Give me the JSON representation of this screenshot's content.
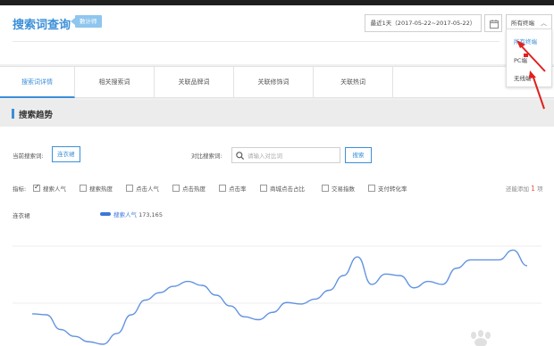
{
  "header": {
    "title": "搜索词查询",
    "badge": "數计师",
    "date_range": "最近1天（2017-05-22~2017-05-22）",
    "terminal_selected": "所有终端",
    "terminal_options": [
      "所有终端",
      "PC端",
      "无线端"
    ]
  },
  "tabs": [
    {
      "label": "搜索词详情",
      "active": true
    },
    {
      "label": "相关搜索词",
      "active": false
    },
    {
      "label": "关联品牌词",
      "active": false
    },
    {
      "label": "关联修饰词",
      "active": false
    },
    {
      "label": "关联热词",
      "active": false
    }
  ],
  "section": {
    "title": "搜索趋势"
  },
  "filters": {
    "current_label": "当前搜索词:",
    "current_value": "连衣裙",
    "compare_label": "对比搜索词:",
    "compare_placeholder": "请输入对比词",
    "search_label": "搜索"
  },
  "metrics": {
    "label": "指标:",
    "items": [
      {
        "label": "搜索人气",
        "checked": true
      },
      {
        "label": "搜索热度",
        "checked": false
      },
      {
        "label": "点击人气",
        "checked": false
      },
      {
        "label": "点击热度",
        "checked": false
      },
      {
        "label": "点击率",
        "checked": false
      },
      {
        "label": "商城点击占比",
        "checked": false
      },
      {
        "label": "交易指数",
        "checked": false
      },
      {
        "label": "支付转化率",
        "checked": false
      }
    ],
    "count_prefix": "还能添加",
    "count_value": "1",
    "count_suffix": "项"
  },
  "legend": {
    "keyword": "连衣裙",
    "series_name": "搜索人气",
    "series_value": "173,165",
    "color": "#3b78d8"
  },
  "chart_data": {
    "type": "line",
    "series": [
      {
        "name": "搜索人气",
        "values": [
          0.62,
          0.6,
          0.3,
          0.16,
          0.05,
          0.0,
          0.22,
          0.6,
          0.9,
          1.05,
          1.18,
          1.28,
          1.2,
          1.0,
          0.78,
          0.56,
          0.5,
          0.65,
          0.85,
          0.82,
          0.92,
          1.1,
          1.4,
          1.78,
          1.22,
          1.43,
          1.4,
          1.15,
          1.28,
          1.22,
          1.55,
          1.72,
          1.72,
          1.72,
          1.92,
          1.6
        ]
      }
    ],
    "grid": true,
    "xlabel": "",
    "ylabel": ""
  }
}
